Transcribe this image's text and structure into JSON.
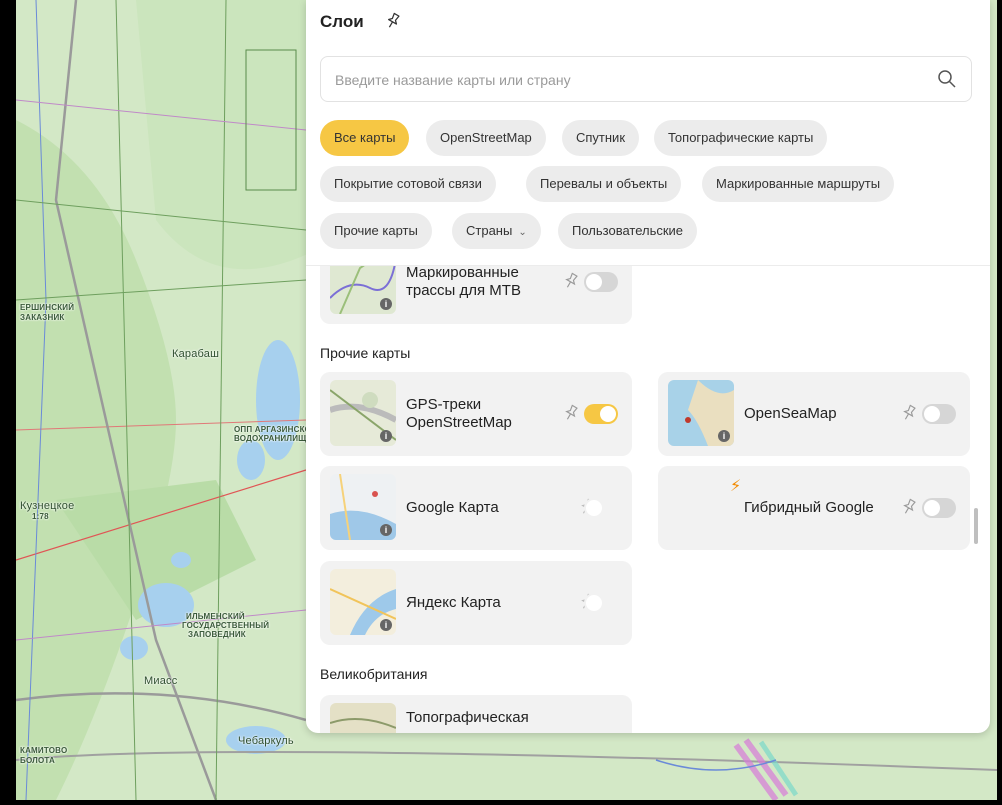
{
  "map": {
    "labels": [
      "Карабаш",
      "Миасс",
      "Чебаркуль",
      "Кузнецкое"
    ],
    "small_labels": [
      "ЕРШИНСКИЙ",
      "ЗАКАЗНИК",
      "ОПП АРГАЗИНСКОЕ",
      "ВОДОХРАНИЛИЩЕ",
      "ИЛЬМЕНСКИЙ",
      "ГОСУДАРСТВЕННЫЙ",
      "ЗАПОВЕДНИК",
      "КАМИТОВО",
      "БОЛОТА",
      "1:78"
    ]
  },
  "panel": {
    "title": "Слои",
    "search": {
      "placeholder": "Введите название карты или страну",
      "value": ""
    },
    "chips": [
      {
        "label": "Все карты",
        "active": true
      },
      {
        "label": "OpenStreetMap",
        "active": false
      },
      {
        "label": "Спутник",
        "active": false
      },
      {
        "label": "Топографические карты",
        "active": false
      },
      {
        "label": "Покрытие сотовой связи",
        "active": false
      },
      {
        "label": "Перевалы и объекты",
        "active": false
      },
      {
        "label": "Маркированные маршруты",
        "active": false
      },
      {
        "label": "Прочие карты",
        "active": false
      },
      {
        "label": "Страны",
        "active": false,
        "has_dropdown": true
      },
      {
        "label": "Пользовательские",
        "active": false
      }
    ],
    "cards": {
      "mtb": {
        "name": "Маркированные трассы для MTB",
        "enabled": false
      },
      "gps": {
        "name": "GPS-треки OpenStreetMap",
        "enabled": true
      },
      "opensea": {
        "name": "OpenSeaMap",
        "enabled": false
      },
      "google": {
        "name": "Google Карта",
        "enabled": false
      },
      "hybrid": {
        "name": "Гибридный Google",
        "enabled": false,
        "premium_icon": "lightning-icon"
      },
      "yandex": {
        "name": "Яндекс Карта",
        "enabled": false
      },
      "uk_topo": {
        "name": "Топографическая",
        "enabled": false
      }
    },
    "sections": {
      "other_maps": "Прочие карты",
      "uk": "Великобритания"
    }
  },
  "colors": {
    "accent": "#f6c744",
    "chip": "#ececec",
    "card": "#f2f2f2",
    "bolt": "#f28a00"
  }
}
